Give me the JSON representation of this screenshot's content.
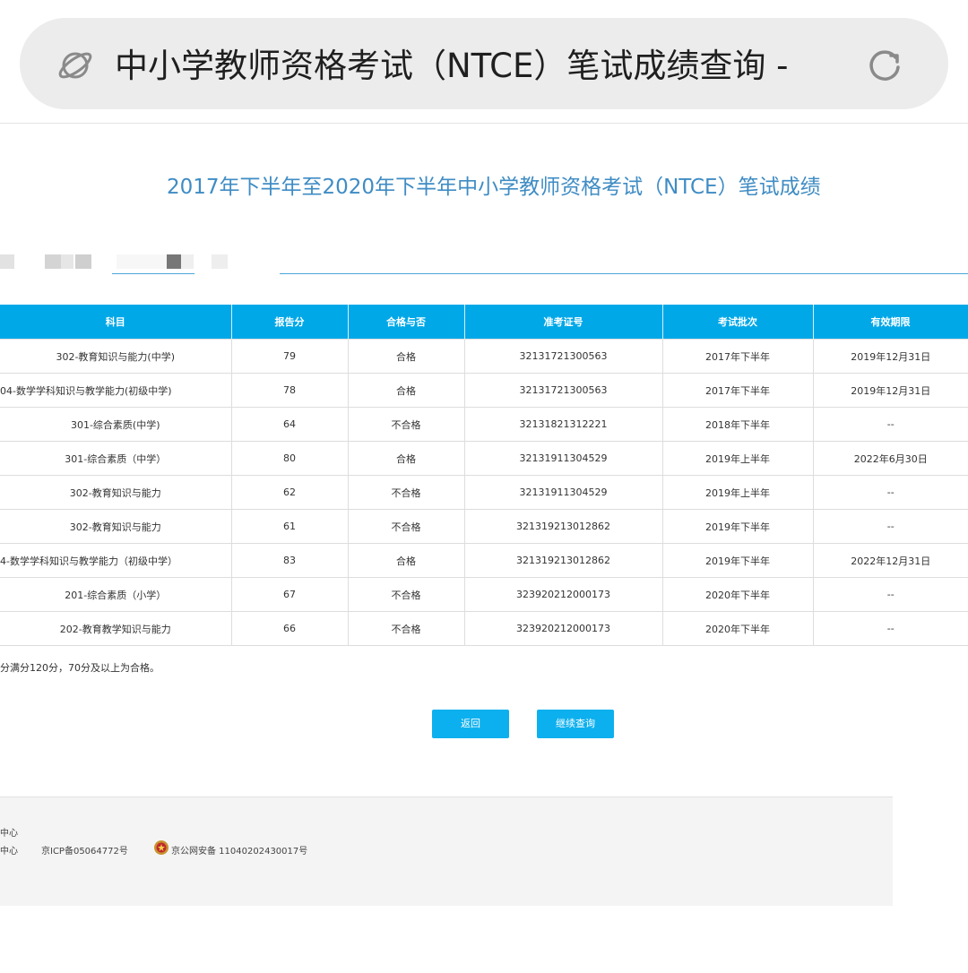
{
  "browser": {
    "title": "中小学教师资格考试（NTCE）笔试成绩查询 -",
    "site_icon": "planet-icon",
    "reload_icon": "reload-icon"
  },
  "page": {
    "heading": "2017年下半年至2020年下半年中小学教师资格考试（NTCE）笔试成绩"
  },
  "table": {
    "headers": [
      "科目",
      "报告分",
      "合格与否",
      "准考证号",
      "考试批次",
      "有效期限"
    ],
    "rows": [
      [
        "302-教育知识与能力(中学)",
        "79",
        "合格",
        "32131721300563",
        "2017年下半年",
        "2019年12月31日"
      ],
      [
        "04-数学学科知识与教学能力(初级中学)",
        "78",
        "合格",
        "32131721300563",
        "2017年下半年",
        "2019年12月31日"
      ],
      [
        "301-综合素质(中学)",
        "64",
        "不合格",
        "32131821312221",
        "2018年下半年",
        "--"
      ],
      [
        "301-综合素质（中学）",
        "80",
        "合格",
        "32131911304529",
        "2019年上半年",
        "2022年6月30日"
      ],
      [
        "302-教育知识与能力",
        "62",
        "不合格",
        "32131911304529",
        "2019年上半年",
        "--"
      ],
      [
        "302-教育知识与能力",
        "61",
        "不合格",
        "321319213012862",
        "2019年下半年",
        "--"
      ],
      [
        "4-数学学科知识与教学能力（初级中学）",
        "83",
        "合格",
        "321319213012862",
        "2019年下半年",
        "2022年12月31日"
      ],
      [
        "201-综合素质（小学）",
        "67",
        "不合格",
        "323920212000173",
        "2020年下半年",
        "--"
      ],
      [
        "202-教育教学知识与能力",
        "66",
        "不合格",
        "323920212000173",
        "2020年下半年",
        "--"
      ]
    ]
  },
  "note": "分满分120分，70分及以上为合格。",
  "buttons": {
    "back": "返回",
    "continue": "继续查询"
  },
  "footer": {
    "line1": "中心",
    "line2": "中心",
    "icp": "京ICP备05064772号",
    "police": "京公网安备 11040202430017号",
    "police_icon": "police-badge-icon"
  },
  "colors": {
    "accent": "#00a8e8",
    "heading": "#3f8cc4",
    "button": "#0db0ee"
  }
}
